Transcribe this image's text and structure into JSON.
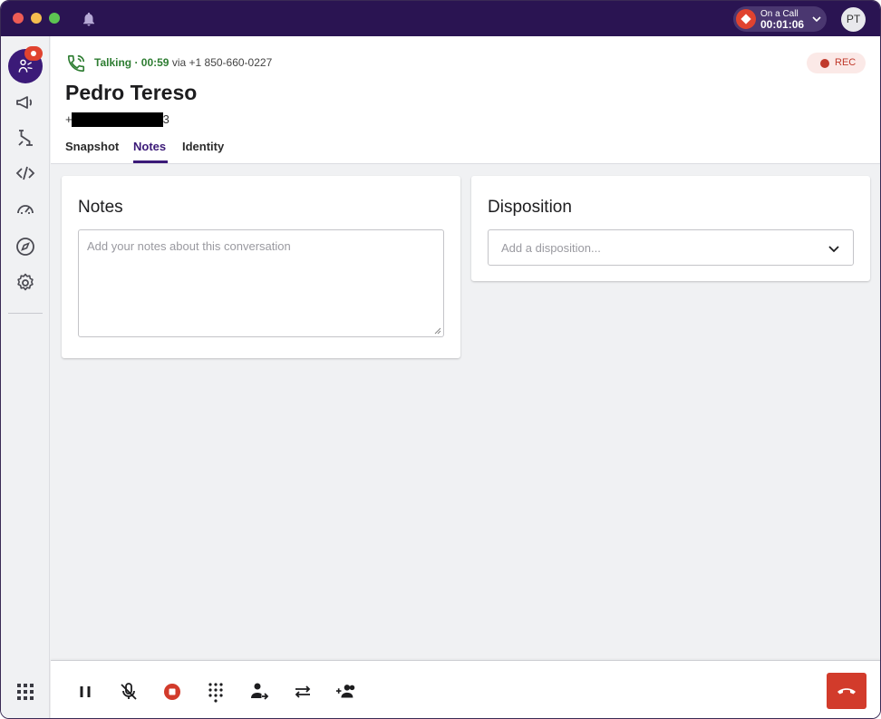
{
  "titlebar": {
    "on_call_label": "On a Call",
    "on_call_timer": "00:01:06",
    "user_initials": "PT"
  },
  "call": {
    "status": "Talking · 00:59",
    "via": "via +1 850-660-0227",
    "rec_label": "REC",
    "contact_name": "Pedro Tereso",
    "contact_phone_prefix": "+",
    "contact_phone_suffix": "3"
  },
  "tabs": [
    {
      "label": "Snapshot"
    },
    {
      "label": "Notes"
    },
    {
      "label": "Identity"
    }
  ],
  "notes": {
    "title": "Notes",
    "placeholder": "Add your notes about this conversation"
  },
  "disposition": {
    "title": "Disposition",
    "placeholder": "Add a disposition..."
  },
  "icons": {
    "sidebar": [
      "agent-icon",
      "megaphone-icon",
      "flow-icon",
      "code-icon",
      "speedometer-icon",
      "compass-icon",
      "settings-icon",
      "apps-grid-icon"
    ],
    "toolbar": [
      "pause-icon",
      "mute-icon",
      "stop-record-icon",
      "dialpad-icon",
      "transfer-person-icon",
      "swap-icon",
      "add-participant-icon",
      "hangup-icon"
    ]
  },
  "colors": {
    "titlebar": "#2a1452",
    "accent": "#3b1a78",
    "call_red": "#e0432f",
    "talk_green": "#2e7d32"
  }
}
